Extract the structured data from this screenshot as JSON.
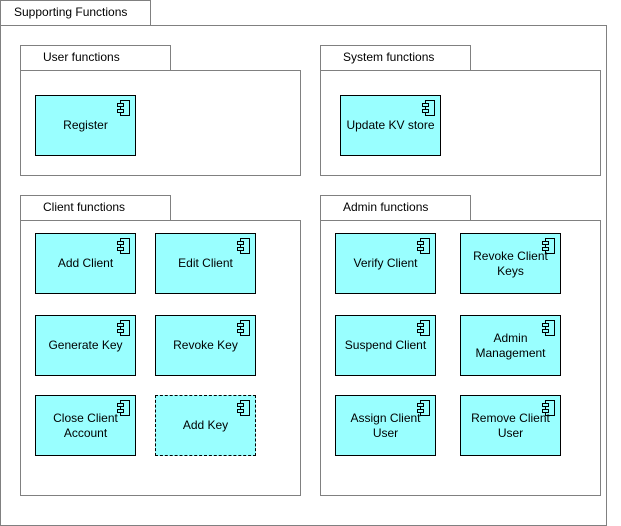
{
  "diagram": {
    "title": "Supporting Functions",
    "packages": [
      {
        "name": "User functions",
        "components": [
          {
            "label": "Register",
            "icon": "component-icon",
            "style": "solid"
          }
        ]
      },
      {
        "name": "System functions",
        "components": [
          {
            "label": "Update KV store",
            "icon": "component-icon",
            "style": "solid"
          }
        ]
      },
      {
        "name": "Client functions",
        "components": [
          {
            "label": "Add Client",
            "icon": "component-icon",
            "style": "solid"
          },
          {
            "label": "Edit Client",
            "icon": "component-icon",
            "style": "solid"
          },
          {
            "label": "Generate Key",
            "icon": "component-icon",
            "style": "solid"
          },
          {
            "label": "Revoke Key",
            "icon": "component-icon",
            "style": "solid"
          },
          {
            "label": "Close Client Account",
            "icon": "component-icon",
            "style": "solid"
          },
          {
            "label": "Add Key",
            "icon": "component-icon",
            "style": "dashed"
          }
        ]
      },
      {
        "name": "Admin functions",
        "components": [
          {
            "label": "Verify Client",
            "icon": "component-icon",
            "style": "solid"
          },
          {
            "label": "Revoke Client Keys",
            "icon": "component-icon",
            "style": "solid"
          },
          {
            "label": "Suspend Client",
            "icon": "component-icon",
            "style": "solid"
          },
          {
            "label": "Admin Management",
            "icon": "component-icon",
            "style": "solid"
          },
          {
            "label": "Assign Client User",
            "icon": "component-icon",
            "style": "solid"
          },
          {
            "label": "Remove Client User",
            "icon": "component-icon",
            "style": "solid"
          }
        ]
      }
    ],
    "colors": {
      "component_fill": "#99ffff",
      "component_border": "#000000",
      "package_border": "#808080"
    }
  }
}
